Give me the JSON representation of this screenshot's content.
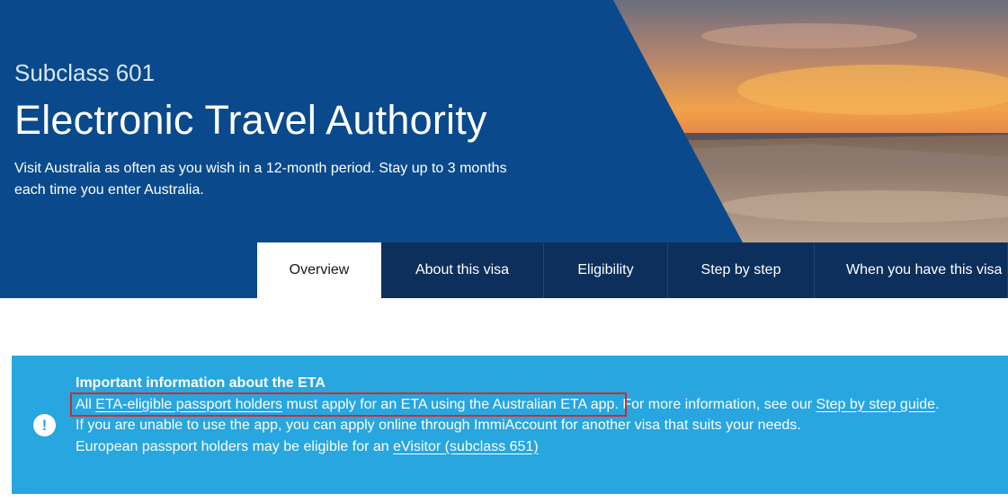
{
  "hero": {
    "subtitle": "Subclass 601",
    "title": "Electronic Travel Authority",
    "description": "Visit Australia as often as you wish in a 12-month period. Stay up to 3 months each time you enter Australia."
  },
  "tabs": [
    {
      "label": "Overview",
      "active": true
    },
    {
      "label": "About this visa",
      "active": false
    },
    {
      "label": "Eligibility",
      "active": false
    },
    {
      "label": "Step by step",
      "active": false
    },
    {
      "label": "When you have this visa",
      "active": false
    }
  ],
  "notice": {
    "icon": "exclamation-circle-icon",
    "title": "Important information about the ETA",
    "line1": {
      "prefix": "All ",
      "link1": "ETA-eligible passport holders",
      "middle": " must apply for an ETA using the Australian ETA app.",
      "after": " For more information, see our ",
      "link2": "Step by step guide",
      "end": "."
    },
    "line2": "If you are unable to use the app, you can apply online through ImmiAccount for another visa that suits your needs.",
    "line3": {
      "prefix": "European passport holders may be eligible for an ",
      "link": "eVisitor (subclass 651)"
    }
  },
  "colors": {
    "hero_blue": "#0a4a8c",
    "tab_dark": "#0d2f5c",
    "notice_blue": "#27a6e0",
    "highlight_red": "#d42a2a"
  }
}
